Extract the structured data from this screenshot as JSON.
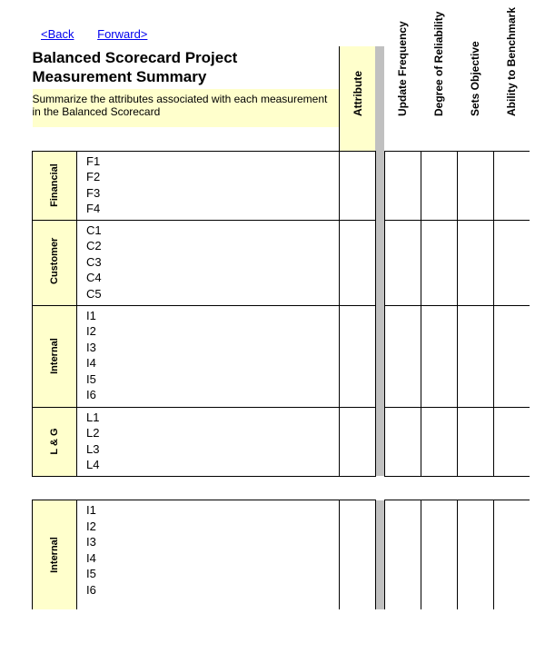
{
  "nav": {
    "back": "<Back",
    "forward": "Forward>"
  },
  "title": "Balanced Scorecard Project Measurement Summary",
  "subtitle": "Summarize the attributes associated with each measurement in the Balanced Scorecard",
  "columns": {
    "attribute": "Attribute",
    "update_frequency": "Update Frequency",
    "degree_reliability": "Degree of Reliability",
    "sets_objective": "Sets Objective",
    "ability_benchmark": "Ability to Benchmark"
  },
  "groups": [
    {
      "name": "Financial",
      "items": [
        "F1",
        "F2",
        "F3",
        "F4"
      ]
    },
    {
      "name": "Customer",
      "items": [
        "C1",
        "C2",
        "C3",
        "C4",
        "C5"
      ]
    },
    {
      "name": "Internal",
      "items": [
        "I1",
        "I2",
        "I3",
        "I4",
        "I5",
        "I6"
      ]
    },
    {
      "name": "L & G",
      "items": [
        "L1",
        "L2",
        "L3",
        "L4"
      ]
    }
  ],
  "second_group": {
    "name": "Internal",
    "items": [
      "I1",
      "I2",
      "I3",
      "I4",
      "I5",
      "I6"
    ]
  }
}
